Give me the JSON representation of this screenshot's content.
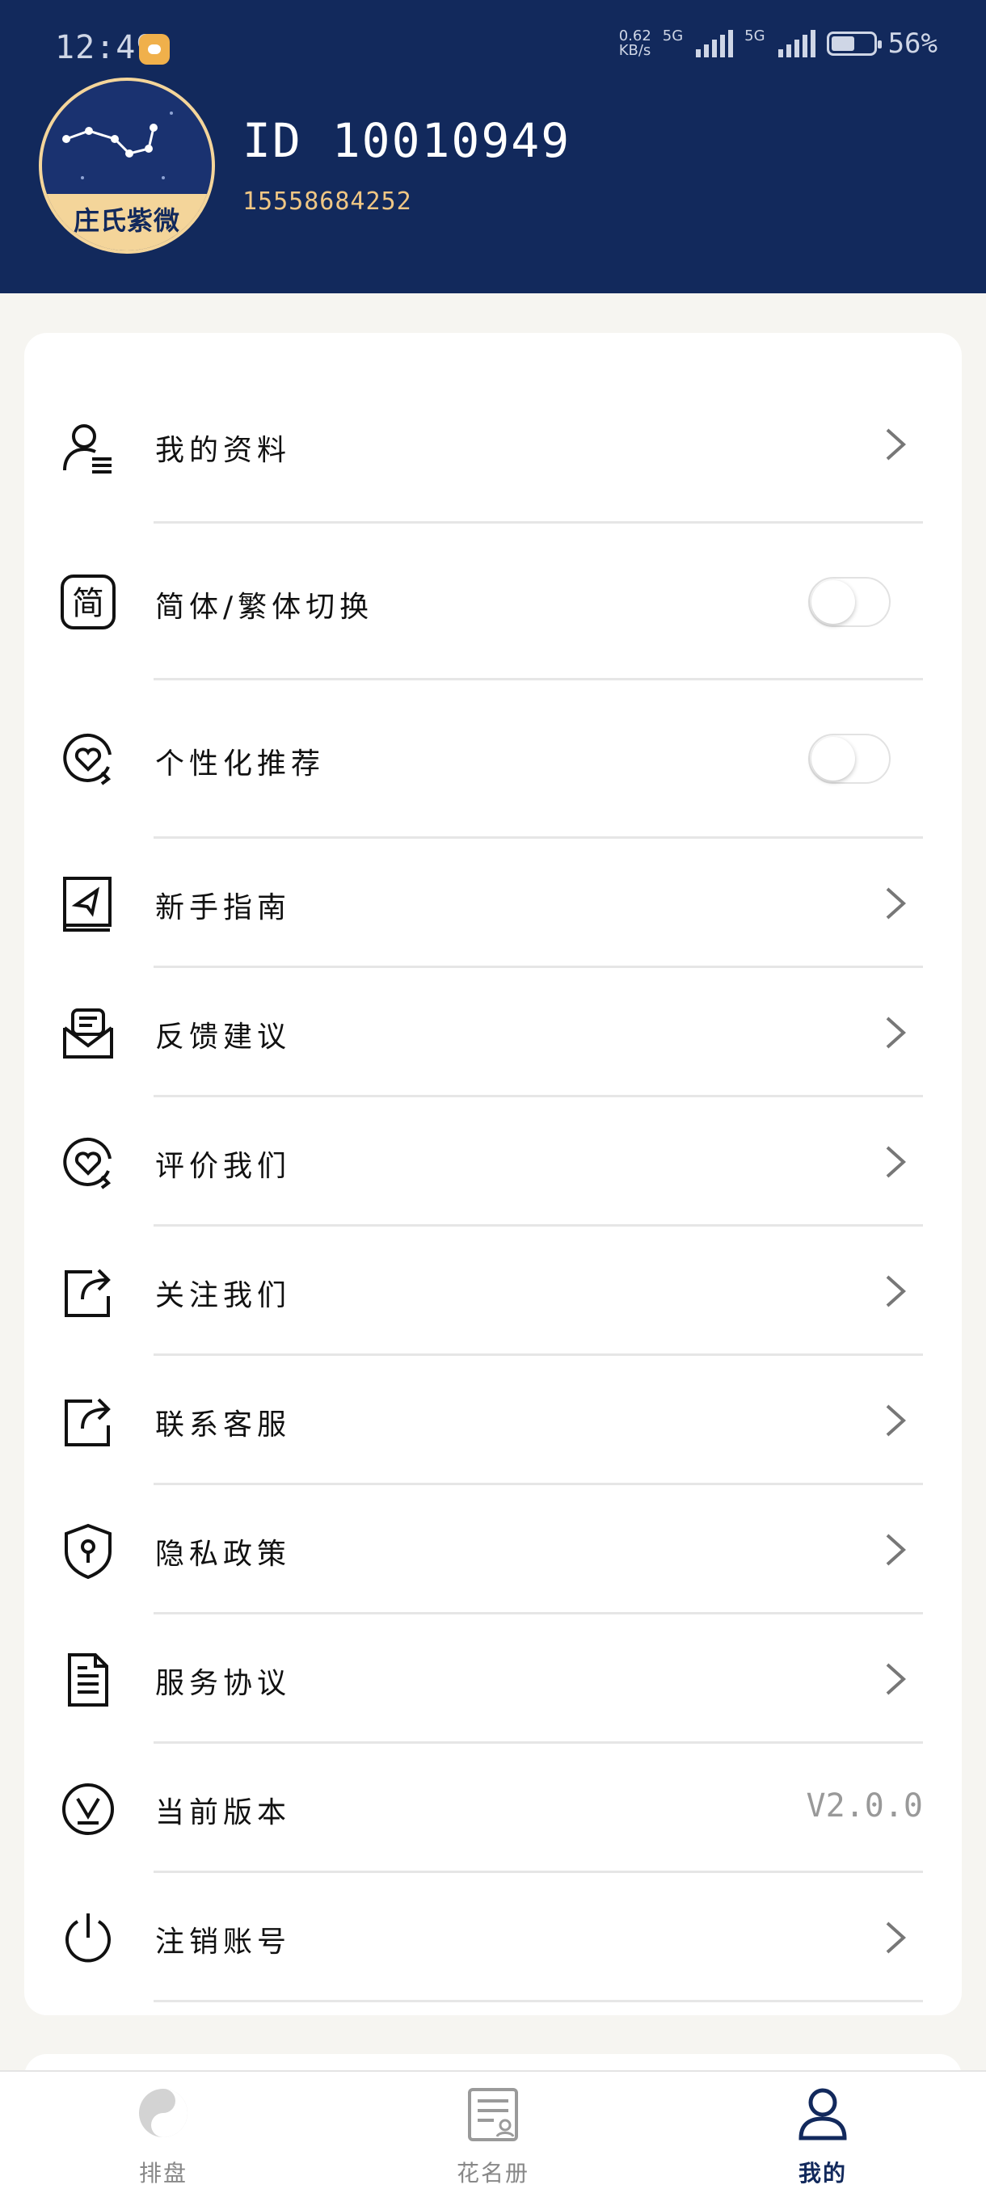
{
  "status_bar": {
    "time": "12:49",
    "net_speed_value": "0.62",
    "net_speed_unit": "KB/s",
    "signal1_label": "5G",
    "signal2_label": "5G",
    "battery_percent": "56%",
    "battery_level": 0.56
  },
  "profile": {
    "avatar_text": "庄氏紫微",
    "user_id": "ID 10010949",
    "phone": "15558684252"
  },
  "menu": [
    {
      "label": "我的资料",
      "icon": "user-list-icon",
      "control": "chevron"
    },
    {
      "label": "简体/繁体切换",
      "icon": "simplified-char-icon",
      "control": "toggle",
      "on": false
    },
    {
      "label": "个性化推荐",
      "icon": "heart-refresh-icon",
      "control": "toggle",
      "on": false
    },
    {
      "label": "新手指南",
      "icon": "guide-book-icon",
      "control": "chevron"
    },
    {
      "label": "反馈建议",
      "icon": "feedback-mail-icon",
      "control": "chevron"
    },
    {
      "label": "评价我们",
      "icon": "heart-refresh-icon",
      "control": "chevron"
    },
    {
      "label": "关注我们",
      "icon": "share-icon",
      "control": "chevron"
    },
    {
      "label": "联系客服",
      "icon": "share-icon",
      "control": "chevron"
    },
    {
      "label": "隐私政策",
      "icon": "shield-lock-icon",
      "control": "chevron"
    },
    {
      "label": "服务协议",
      "icon": "document-icon",
      "control": "chevron"
    },
    {
      "label": "当前版本",
      "icon": "version-icon",
      "control": "value",
      "value": "V2.0.0"
    },
    {
      "label": "注销账号",
      "icon": "power-icon",
      "control": "chevron"
    }
  ],
  "tabs": [
    {
      "label": "排盘",
      "icon": "yin-yang-icon",
      "active": false
    },
    {
      "label": "花名册",
      "icon": "roster-icon",
      "active": false
    },
    {
      "label": "我的",
      "icon": "person-icon",
      "active": true
    }
  ],
  "colors": {
    "header_bg": "#12295c",
    "accent_gold": "#f4d59a",
    "phone_text": "#f0c784"
  }
}
